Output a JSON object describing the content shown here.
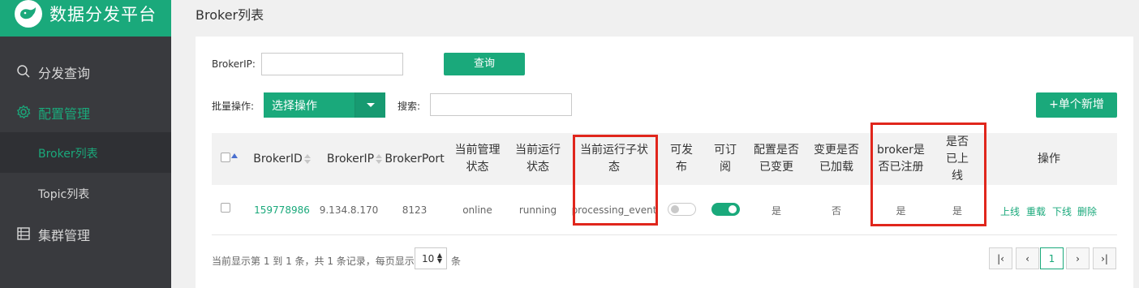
{
  "app": {
    "title": "数据分发平台"
  },
  "sidebar": {
    "items": [
      {
        "label": "分发查询",
        "icon": "search-icon"
      },
      {
        "label": "配置管理",
        "icon": "gear-icon"
      },
      {
        "label": "Broker列表"
      },
      {
        "label": "Topic列表"
      },
      {
        "label": "集群管理",
        "icon": "list-icon"
      }
    ]
  },
  "page": {
    "title": "Broker列表"
  },
  "filters": {
    "broker_ip_label": "BrokerIP:",
    "broker_ip_value": "",
    "query_button": "查询",
    "batch_label": "批量操作:",
    "batch_select": "选择操作",
    "search_label": "搜索:",
    "search_value": "",
    "add_button": "+单个新增"
  },
  "table": {
    "headers": {
      "broker_id": "BrokerID",
      "broker_ip": "BrokerIP",
      "broker_port": "BrokerPort",
      "manage_status_1": "当前管理",
      "manage_status_2": "状态",
      "run_status_1": "当前运行",
      "run_status_2": "状态",
      "sub_status_1": "当前运行子状",
      "sub_status_2": "态",
      "publish_1": "可发",
      "publish_2": "布",
      "subscribe_1": "可订",
      "subscribe_2": "阅",
      "config_changed_1": "配置是否",
      "config_changed_2": "已变更",
      "change_loaded_1": "变更是否",
      "change_loaded_2": "已加载",
      "registered_1": "broker是",
      "registered_2": "否已注册",
      "online_1": "是否",
      "online_2": "已上",
      "online_3": "线",
      "ops": "操作"
    },
    "rows": [
      {
        "broker_id": "159778986",
        "broker_ip": "9.134.8.170",
        "broker_port": "8123",
        "manage_status": "online",
        "run_status": "running",
        "sub_status": "processing_event",
        "publish": false,
        "subscribe": true,
        "config_changed": "是",
        "change_loaded": "否",
        "registered": "是",
        "online": "是",
        "actions": [
          "上线",
          "重载",
          "下线",
          "删除"
        ]
      }
    ]
  },
  "pagination": {
    "summary": "当前显示第 1 到 1 条，共 1 条记录，每页显示",
    "page_size": "10",
    "suffix": "条",
    "current_page": "1"
  },
  "colors": {
    "accent": "#1aa97b",
    "sidebar": "#393a3e",
    "highlight": "#e0261c"
  }
}
